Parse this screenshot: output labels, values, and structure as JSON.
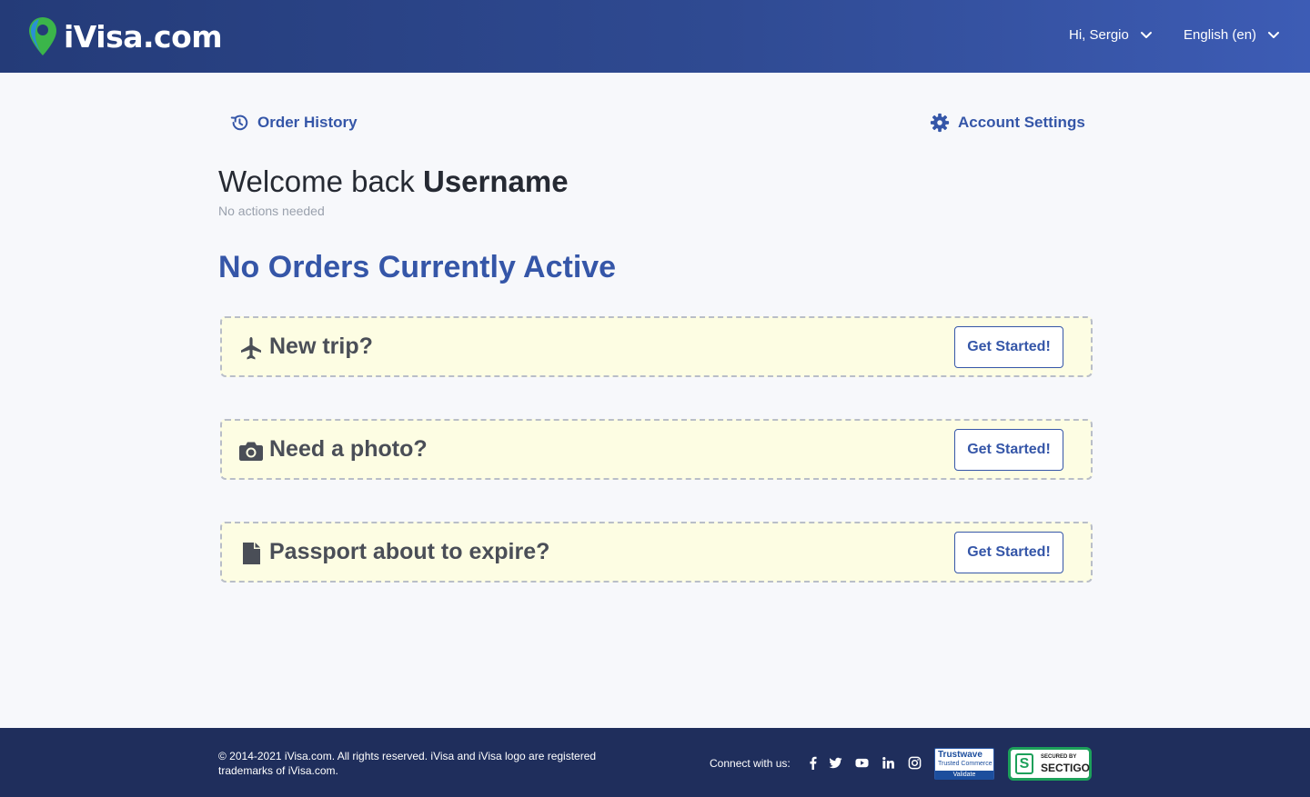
{
  "header": {
    "logo_text": "iVisa.com",
    "user_menu_label": "Hi, Sergio",
    "language_label": "English (en)"
  },
  "nav": {
    "order_history_label": "Order History",
    "account_settings_label": "Account Settings"
  },
  "welcome": {
    "prefix": "Welcome back ",
    "username": "Username",
    "subtext": "No actions needed"
  },
  "status_title": "No Orders Currently Active",
  "cards": [
    {
      "icon": "airplane-icon",
      "title": "New trip?",
      "button_label": "Get Started!"
    },
    {
      "icon": "camera-icon",
      "title": "Need a photo?",
      "button_label": "Get Started!"
    },
    {
      "icon": "document-icon",
      "title": "Passport about to expire?",
      "button_label": "Get Started!"
    }
  ],
  "footer": {
    "copyright": "© 2014-2021 iVisa.com. All rights reserved. iVisa and iVisa logo are registered trademarks of iVisa.com.",
    "connect_label": "Connect with us:",
    "social_icons": [
      "facebook-icon",
      "twitter-icon",
      "youtube-icon",
      "linkedin-icon",
      "instagram-icon"
    ],
    "badges": {
      "trustwave_line1": "Trustwave",
      "trustwave_line2": "Trusted Commerce",
      "trustwave_line3": "Validate",
      "sectigo_line1": "SECURED BY",
      "sectigo_line2": "SECTIGO"
    }
  },
  "colors": {
    "header_start": "#243b78",
    "header_end": "#3d5cb5",
    "accent": "#3556a8",
    "card_bg": "#fdfde3",
    "footer_bg": "#1f2e5c"
  }
}
